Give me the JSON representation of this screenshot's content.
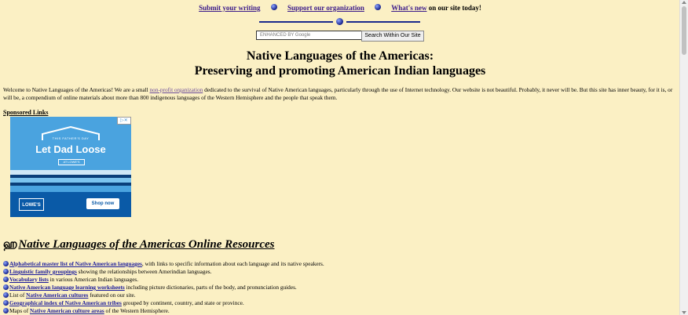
{
  "nav": {
    "submit": "Submit your writing",
    "support": "Support our organization",
    "whats_new": "What's new",
    "whats_new_suffix": " on our site today!"
  },
  "search": {
    "placeholder": "ENHANCED BY Google",
    "button": "Search Within Our Site"
  },
  "title": {
    "line1": "Native Languages of the Americas:",
    "line2": "Preserving and promoting American Indian languages"
  },
  "intro": {
    "part1": "Welcome to Native Languages of the Americas! We are a small ",
    "link": "non-profit organization",
    "part2": " dedicated to the survival of Native American languages, particularly through the use of Internet technology. Our website is not beautiful. Probably, it never will be. But this site has inner beauty, for it is, or will be, a compendium of online materials about more than 800 indigenous languages of the Western Hemisphere and the people that speak them."
  },
  "sponsored": "Sponsored Links",
  "ad": {
    "small": "THIS FATHER'S DAY",
    "headline": "Let Dad Loose",
    "sub": "AT LOWE'S",
    "brand": "LOWE'S",
    "cta": "Shop now"
  },
  "resources": {
    "heading": "Native Languages of the Americas Online Resources",
    "items": [
      {
        "pre": "",
        "link": "Alphabetical master list of Native American languages",
        "post": ", with links to specific information about each language and its native speakers.",
        "bullet": true
      },
      {
        "pre": "",
        "link": "Linguistic family groupings",
        "post": " showing the relationships between Amerindian languages.",
        "bullet": true
      },
      {
        "pre": "",
        "link": "Vocabulary lists",
        "post": " in various American Indian languages.",
        "bullet": true
      },
      {
        "pre": "",
        "link": "Native American language learning worksheets",
        "post": " including picture dictionaries, parts of the body, and pronunciation guides.",
        "bullet": true
      },
      {
        "pre": "List of ",
        "link": "Native American cultures",
        "post": " featured on our site.",
        "bullet": true
      },
      {
        "pre": "",
        "link": "Geographical index of Native American tribes",
        "post": " grouped by continent, country, and state or province.",
        "bullet": true
      },
      {
        "pre": "Maps of ",
        "link": "Native American culture areas",
        "post": " of the Western Hemisphere.",
        "bullet": true
      }
    ]
  }
}
